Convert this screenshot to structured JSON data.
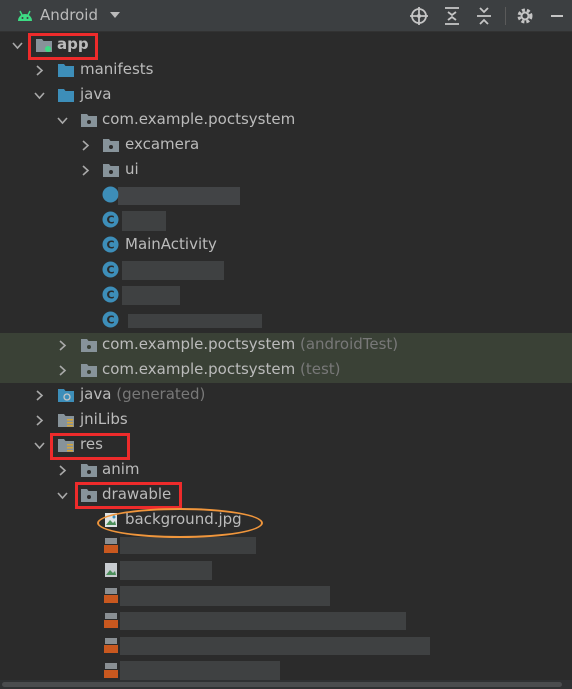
{
  "toolbar": {
    "title": "Android",
    "icons": [
      "android-icon",
      "caret-down-icon",
      "locate-icon",
      "expand-all-icon",
      "collapse-all-icon",
      "gear-icon",
      "minimize-icon"
    ]
  },
  "tree": {
    "app": "app",
    "manifests": "manifests",
    "java": "java",
    "package_main": "com.example.poctsystem",
    "excamera": "excamera",
    "ui": "ui",
    "main_activity": "MainActivity",
    "package_android_test": "com.example.poctsystem",
    "package_android_test_suffix": "(androidTest)",
    "package_test": "com.example.poctsystem",
    "package_test_suffix": "(test)",
    "java_generated": "java",
    "java_generated_suffix": "(generated)",
    "jnilibs": "jniLibs",
    "res": "res",
    "anim": "anim",
    "drawable": "drawable",
    "background_file": "background.jpg"
  },
  "colors": {
    "background": "#2b2b2b",
    "toolbar": "#3c3f41",
    "folder": "#87939a",
    "folder_blue": "#3d8eb9",
    "class_icon": "#3d8eb9",
    "highlight_row": "#3a4136",
    "annotation_red": "#ee2b2b",
    "annotation_orange": "#f0963c",
    "android_green": "#3ddc84"
  }
}
